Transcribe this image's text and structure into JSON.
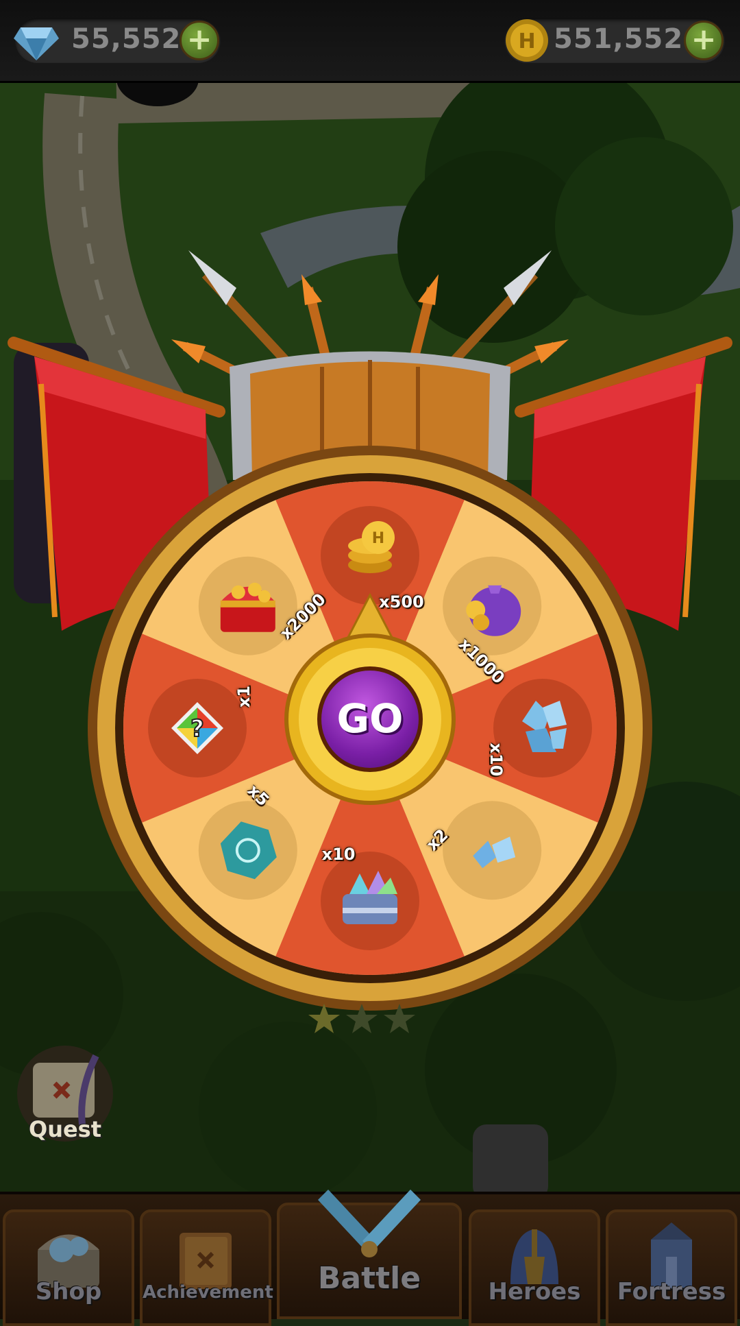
{
  "resources": {
    "gems": "55,552",
    "coins": "551,552",
    "add_symbol": "+"
  },
  "wheel": {
    "spin_label": "GO",
    "prizes": [
      {
        "amount": "x500",
        "item": "gold-coins-icon"
      },
      {
        "amount": "x1000",
        "item": "coin-bag-icon"
      },
      {
        "amount": "x10",
        "item": "crystal-cluster-icon"
      },
      {
        "amount": "x2",
        "item": "small-crystals-icon"
      },
      {
        "amount": "x10",
        "item": "crystal-chest-icon"
      },
      {
        "amount": "x5",
        "item": "rune-stone-icon"
      },
      {
        "amount": "x1",
        "item": "mystery-cube-icon"
      },
      {
        "amount": "x2000",
        "item": "treasure-chest-icon"
      }
    ]
  },
  "quest": {
    "label": "Quest"
  },
  "nav": {
    "shop": "Shop",
    "achievement": "Achievement",
    "battle": "Battle",
    "heroes": "Heroes",
    "fortress": "Fortress"
  },
  "colors": {
    "slice_dark": "#e0552e",
    "slice_light": "#f9c56f",
    "rim_gold": "#d9a33a",
    "banner_red": "#c8161b",
    "go_purple": "#8a2bb8"
  }
}
